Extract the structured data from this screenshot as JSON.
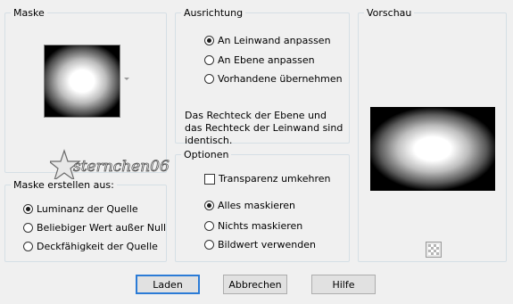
{
  "mask_group": {
    "legend": "Maske"
  },
  "create_group": {
    "legend": "Maske erstellen aus:",
    "options": [
      {
        "label": "Luminanz der Quelle",
        "checked": true
      },
      {
        "label": "Beliebiger Wert außer Null",
        "checked": false
      },
      {
        "label": "Deckfähigkeit der Quelle",
        "checked": false
      }
    ]
  },
  "align_group": {
    "legend": "Ausrichtung",
    "options": [
      {
        "label": "An Leinwand anpassen",
        "checked": true
      },
      {
        "label": "An Ebene anpassen",
        "checked": false
      },
      {
        "label": "Vorhandene übernehmen",
        "checked": false
      }
    ],
    "description": "Das Rechteck der Ebene und das Rechteck der Leinwand sind identisch."
  },
  "options_group": {
    "legend": "Optionen",
    "invert_label": "Transparenz umkehren",
    "invert_checked": false,
    "options": [
      {
        "label": "Alles maskieren",
        "checked": true
      },
      {
        "label": "Nichts maskieren",
        "checked": false
      },
      {
        "label": "Bildwert verwenden",
        "checked": false
      }
    ]
  },
  "preview_group": {
    "legend": "Vorschau"
  },
  "watermark": {
    "text": "sternchen06"
  },
  "buttons": {
    "load": "Laden",
    "cancel": "Abbrechen",
    "help": "Hilfe"
  },
  "colors": {
    "accent": "#2b7bd6",
    "background": "#f0f0f0",
    "border": "#d5dfe5"
  }
}
